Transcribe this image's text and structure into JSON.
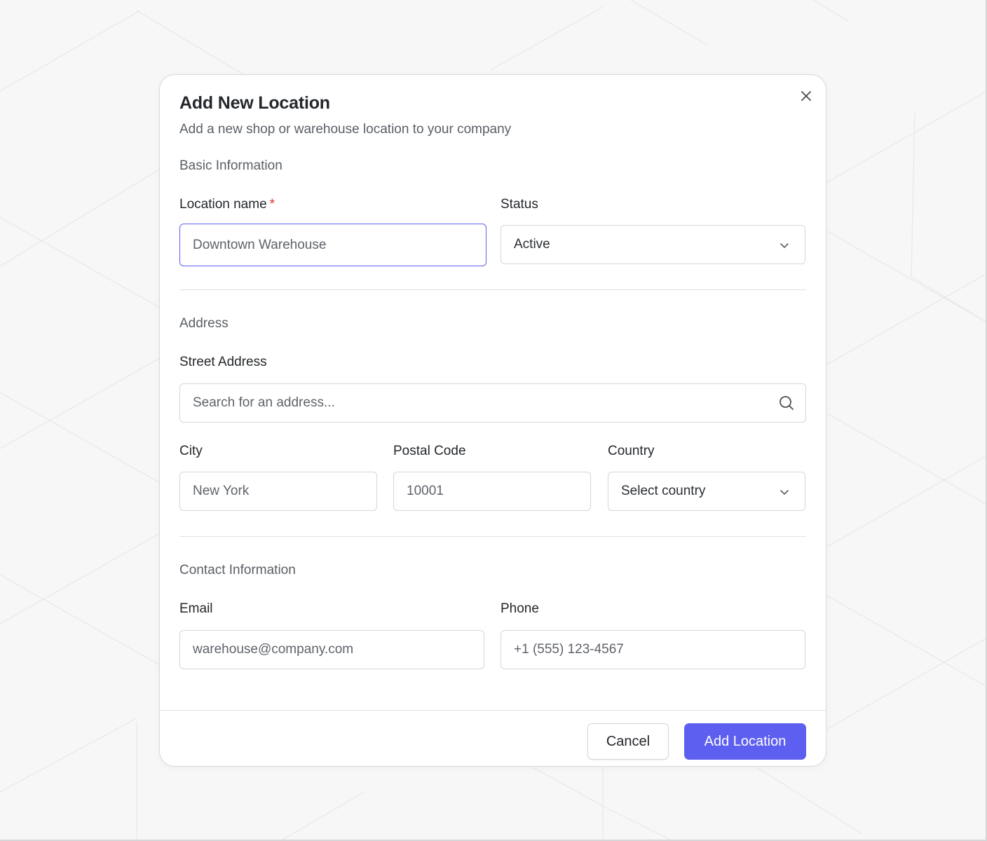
{
  "dialog": {
    "title": "Add New Location",
    "subtitle": "Add a new shop or warehouse location to your company"
  },
  "basic": {
    "heading": "Basic Information",
    "location_name_label": "Location name",
    "required_marker": "*",
    "location_name_placeholder": "Downtown Warehouse",
    "status_label": "Status",
    "status_value": "Active"
  },
  "address": {
    "heading": "Address",
    "street_label": "Street Address",
    "street_placeholder": "Search for an address...",
    "city_label": "City",
    "city_placeholder": "New York",
    "postal_label": "Postal Code",
    "postal_placeholder": "10001",
    "country_label": "Country",
    "country_value": "Select country"
  },
  "contact": {
    "heading": "Contact Information",
    "email_label": "Email",
    "email_placeholder": "warehouse@company.com",
    "phone_label": "Phone",
    "phone_placeholder": "+1 (555) 123-4567"
  },
  "footer": {
    "cancel_label": "Cancel",
    "submit_label": "Add Location"
  },
  "colors": {
    "accent": "#5d5ff0",
    "required": "#e03131",
    "background": "#f7f7f8"
  },
  "icons": {
    "close": "close-icon",
    "chevron": "chevron-down-icon",
    "search": "search-icon"
  }
}
